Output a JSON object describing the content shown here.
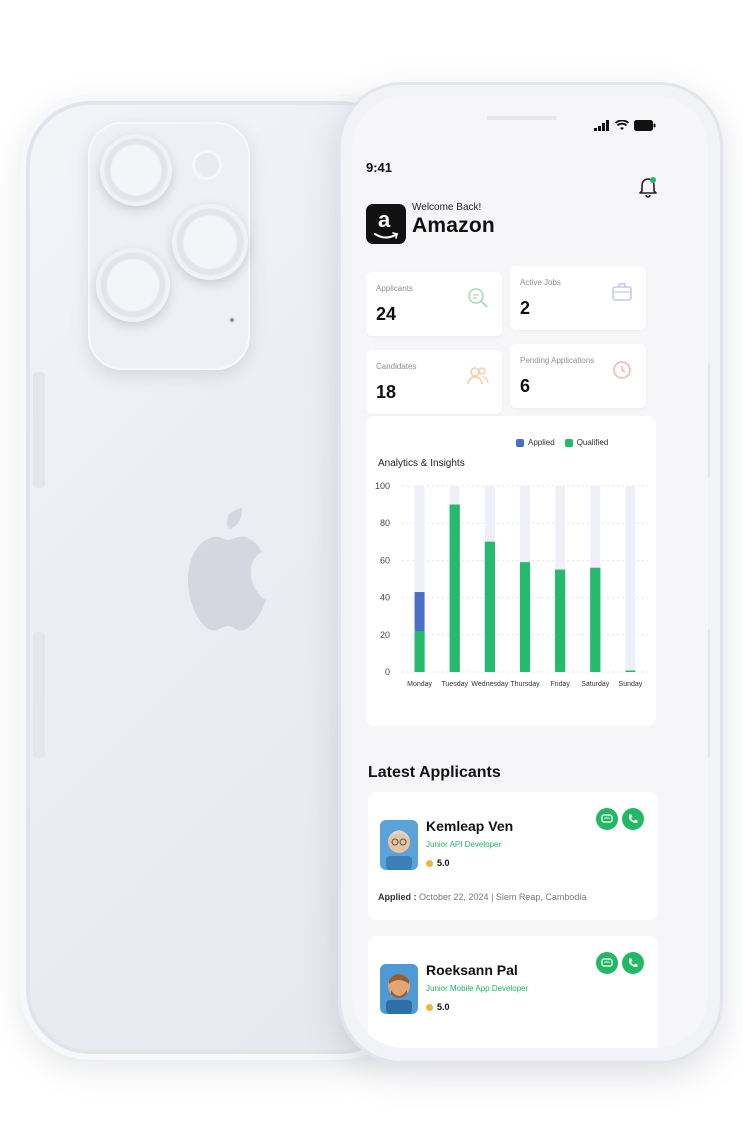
{
  "status": {
    "time": "9:41"
  },
  "header": {
    "welcome": "Welcome Back!",
    "company": "Amazon",
    "logo_letter": "a"
  },
  "stats": [
    {
      "label": "Applicants",
      "value": "24",
      "icon": "search-doc-icon",
      "color": "#2ebd73"
    },
    {
      "label": "Active Jobs",
      "value": "2",
      "icon": "briefcase-icon",
      "color": "#8b97d8"
    },
    {
      "label": "Candidates",
      "value": "18",
      "icon": "users-icon",
      "color": "#f0a36a"
    },
    {
      "label": "Pending Applications",
      "value": "6",
      "icon": "clock-icon",
      "color": "#ef7b7b"
    }
  ],
  "chart_data": {
    "type": "bar",
    "title": "Analytics & Insights",
    "categories": [
      "Monday",
      "Tuesday",
      "Wednesday",
      "Thursday",
      "Friday",
      "Saturday",
      "Sunday"
    ],
    "series": [
      {
        "name": "Applied",
        "values": [
          43,
          90,
          70,
          59,
          55,
          56,
          0
        ],
        "color": "#4a6fc6"
      },
      {
        "name": "Qualified",
        "values": [
          22,
          90,
          70,
          59,
          55,
          56,
          0
        ],
        "color": "#26bb6c"
      }
    ],
    "yticks": [
      "0",
      "20",
      "40",
      "60",
      "80",
      "100"
    ],
    "ylim": [
      0,
      100
    ],
    "grid": true,
    "legend": "top-right"
  },
  "latest": {
    "title": "Latest Applicants",
    "applicants": [
      {
        "name": "Kemleap Ven",
        "role": "Junior API Developer",
        "rating": "5.0",
        "applied_label": "Applied :",
        "applied_text": "October 22, 2024 | Siem Reap, Cambodia"
      },
      {
        "name": "Roeksann Pal",
        "role": "Junior Mobile App Developer",
        "rating": "5.0"
      }
    ]
  },
  "colors": {
    "accent": "#22b864",
    "applied": "#4a6fc6",
    "qualified": "#26bb6c",
    "track": "#eff0f7"
  }
}
